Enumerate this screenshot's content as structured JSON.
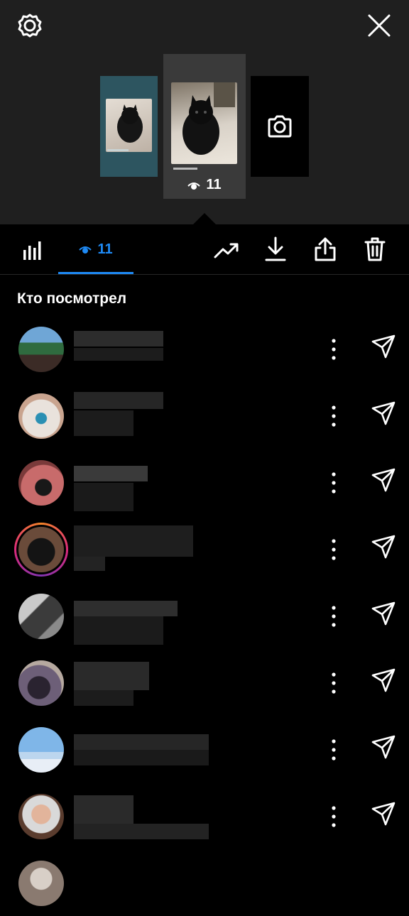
{
  "header": {
    "settings_icon": "gear-icon",
    "close_icon": "close-icon"
  },
  "stories": {
    "left_caption": "",
    "center_caption": "",
    "center_views": "11",
    "right_action_icon": "camera-icon"
  },
  "toolbar": {
    "insights_icon": "bar-chart-icon",
    "views_tab_label": "11",
    "accent_color": "#1e8af5",
    "actions": [
      "trending-up-icon",
      "download-icon",
      "share-icon",
      "trash-icon"
    ]
  },
  "viewers": {
    "title": "Кто посмотрел",
    "items": [
      {
        "avatar": "beach"
      },
      {
        "avatar": "eye"
      },
      {
        "avatar": "woman-pink"
      },
      {
        "avatar": "dog",
        "has_story_ring": true
      },
      {
        "avatar": "man-car"
      },
      {
        "avatar": "couple"
      },
      {
        "avatar": "sky"
      },
      {
        "avatar": "blonde"
      }
    ]
  }
}
